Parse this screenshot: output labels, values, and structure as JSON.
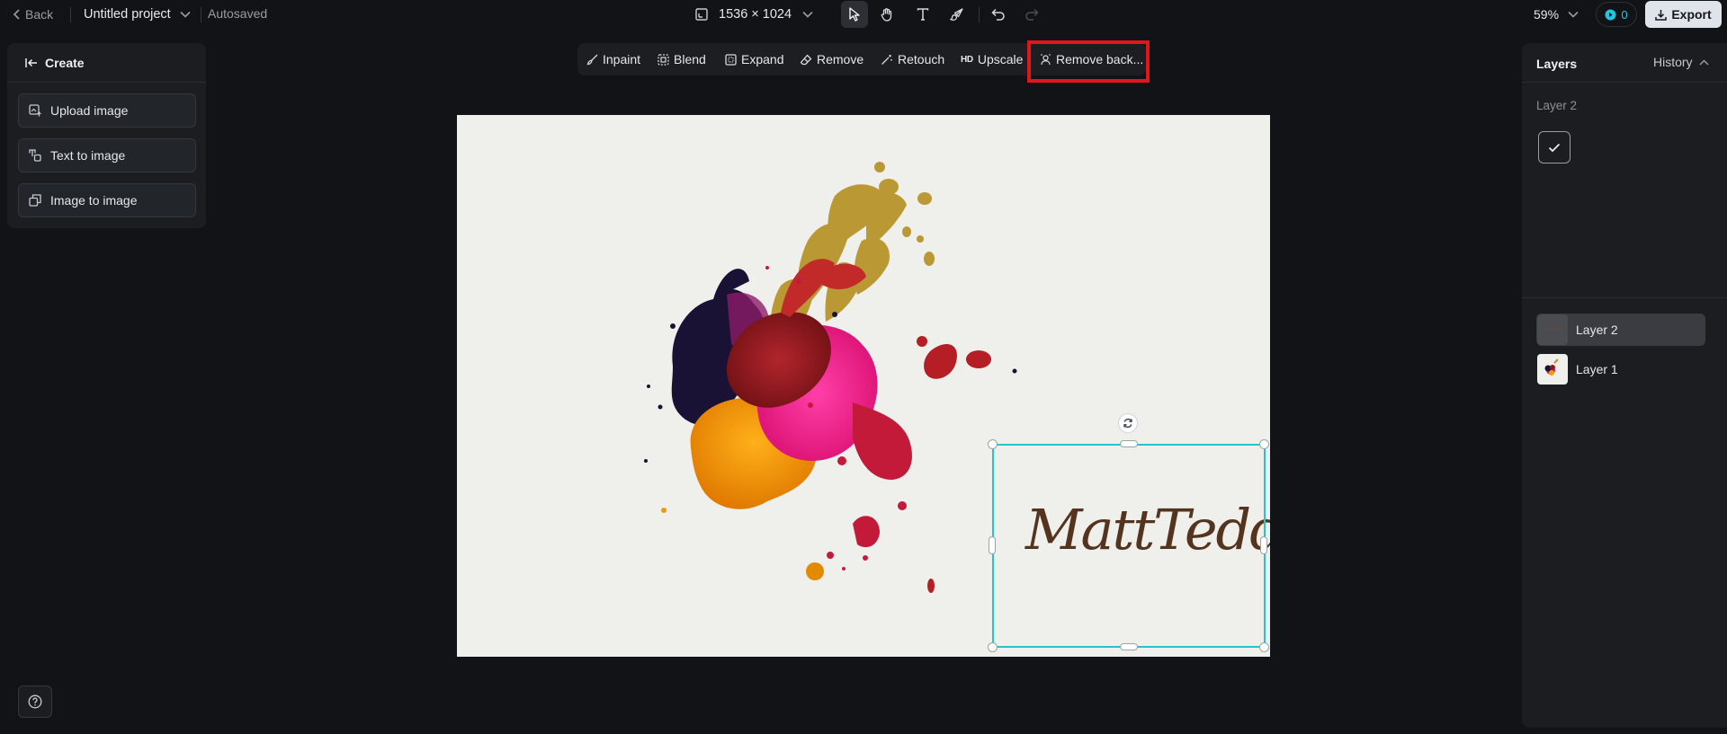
{
  "header": {
    "back_label": "Back",
    "project_name": "Untitled project",
    "save_status": "Autosaved",
    "canvas_size": "1536 × 1024",
    "zoom": "59%",
    "credits": "0",
    "export_label": "Export"
  },
  "tools": [
    "select-tool",
    "hand-tool",
    "text-tool",
    "brush-tool",
    "undo",
    "redo"
  ],
  "left_panel": {
    "title": "Create",
    "buttons": [
      "Upload image",
      "Text to image",
      "Image to image"
    ]
  },
  "edit_toolbar": {
    "items": [
      "Inpaint",
      "Blend",
      "Expand",
      "Remove",
      "Retouch",
      "Upscale",
      "Remove back..."
    ],
    "upscale_badge": "HD",
    "highlighted_item": "Remove back..."
  },
  "canvas": {
    "signature_text": "MattTeddy",
    "selection_color": "#22c4d0"
  },
  "right_panel": {
    "title": "Layers",
    "history_label": "History",
    "selected_layer_label": "Layer 2",
    "layers": [
      {
        "name": "Layer 2",
        "active": true
      },
      {
        "name": "Layer 1",
        "active": false
      }
    ]
  },
  "colors": {
    "background": "#121316",
    "panel": "#1b1d21",
    "highlight": "#e0161d",
    "accent": "#27c2e0"
  }
}
